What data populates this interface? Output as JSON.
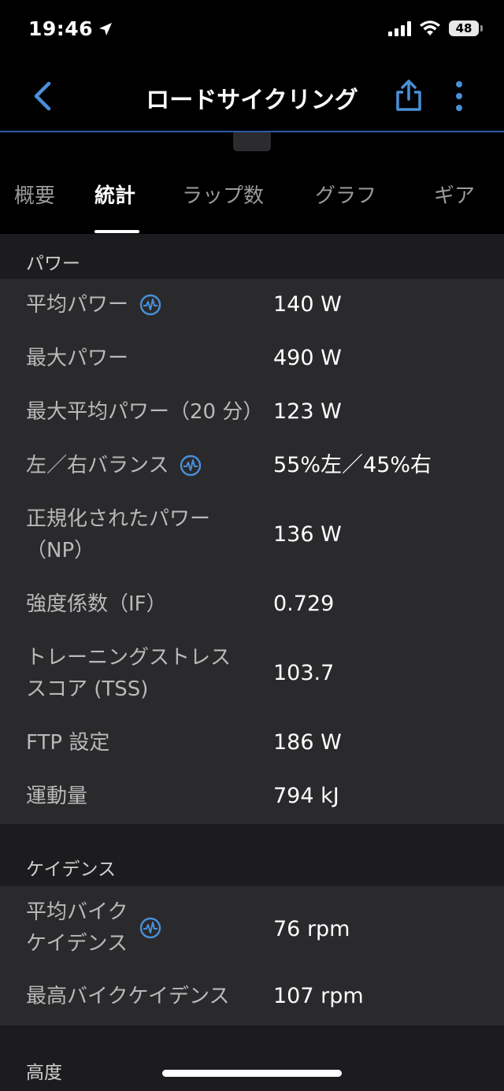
{
  "status_bar": {
    "time": "19:46",
    "battery": "48"
  },
  "nav": {
    "title": "ロードサイクリング"
  },
  "tabs": [
    {
      "label": "概要"
    },
    {
      "label": "統計"
    },
    {
      "label": "ラップ数"
    },
    {
      "label": "グラフ"
    },
    {
      "label": "ギア"
    }
  ],
  "active_tab": "統計",
  "sections": {
    "power": {
      "title": "パワー",
      "rows": [
        {
          "label": "平均パワー",
          "value": "140 W",
          "icon": "power-wave-icon"
        },
        {
          "label": "最大パワー",
          "value": "490 W"
        },
        {
          "label": "最大平均パワー（20 分）",
          "value": "123 W"
        },
        {
          "label": "左／右バランス",
          "value": "55%左／45%右",
          "icon": "power-wave-icon"
        },
        {
          "label_line1": "正規化されたパワー",
          "label_line2": "（NP）",
          "value": "136 W"
        },
        {
          "label": "強度係数（IF）",
          "value": "0.729"
        },
        {
          "label_line1": "トレーニングストレス",
          "label_line2": "スコア (TSS)",
          "value": "103.7"
        },
        {
          "label": "FTP 設定",
          "value": "186 W"
        },
        {
          "label": "運動量",
          "value": "794 kJ"
        }
      ]
    },
    "cadence": {
      "title": "ケイデンス",
      "rows": [
        {
          "label_line1": "平均バイク",
          "label_line2": "ケイデンス",
          "value": "76 rpm",
          "icon": "power-wave-icon"
        },
        {
          "label": "最高バイクケイデンス",
          "value": "107 rpm"
        }
      ]
    },
    "elevation": {
      "title": "高度"
    }
  },
  "colors": {
    "accent": "#4a8fd8",
    "nav_divider": "#2a5b9a",
    "row_bg": "#2a2a2c",
    "header_bg": "#1c1c1e"
  }
}
